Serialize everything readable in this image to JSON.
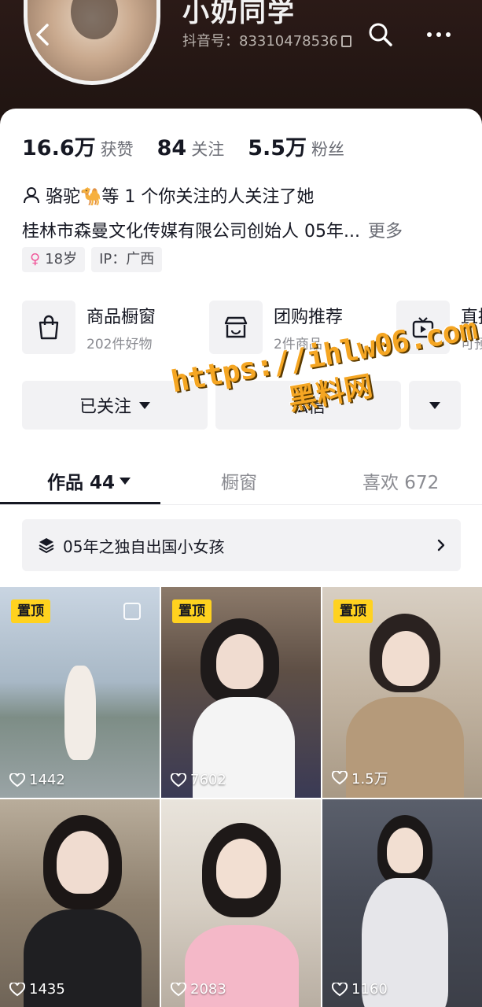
{
  "profile": {
    "nickname": "小奶同学",
    "douyin_id": "抖音号：83310478536",
    "stats": {
      "likes": {
        "value": "16.6万",
        "label": "获赞"
      },
      "following": {
        "value": "84",
        "label": "关注"
      },
      "followers": {
        "value": "5.5万",
        "label": "粉丝"
      }
    },
    "mutual": "骆驼🐪等 1 个你关注的人关注了她",
    "bio": "桂林市森曼文化传媒有限公司创始人 05年...",
    "bio_more": "更多",
    "tags": {
      "age": "18岁",
      "ip": "IP：广西"
    }
  },
  "services": [
    {
      "title": "商品橱窗",
      "sub": "202件好物",
      "icon": "bag-icon"
    },
    {
      "title": "团购推荐",
      "sub": "2件商品",
      "icon": "shop-icon"
    },
    {
      "title": "直播",
      "sub": "可预",
      "icon": "tv-icon"
    }
  ],
  "actions": {
    "followed_label": "已关注",
    "message_label": "私信"
  },
  "watermark": {
    "url": "https://ihlw06.com",
    "name": "黑料网"
  },
  "tabs": [
    {
      "label": "作品 44"
    },
    {
      "label": "橱窗"
    },
    {
      "label": "喜欢 672"
    }
  ],
  "collection": {
    "label": "05年之独自出国小女孩"
  },
  "videos": [
    {
      "pinned": "置顶",
      "likes": "1442"
    },
    {
      "pinned": "置顶",
      "likes": "7602"
    },
    {
      "pinned": "置顶",
      "likes": "1.5万"
    },
    {
      "pinned": "",
      "likes": "1435"
    },
    {
      "pinned": "",
      "likes": "2083"
    },
    {
      "pinned": "",
      "likes": "1160"
    }
  ],
  "colors": {
    "header_bg": "#2b1a17",
    "pin_badge": "#ffd21f",
    "text_primary": "#161823",
    "text_secondary": "#6b6d75",
    "chip_bg": "#f2f2f4",
    "watermark": "#f5a623",
    "gender": "#f0599b"
  }
}
